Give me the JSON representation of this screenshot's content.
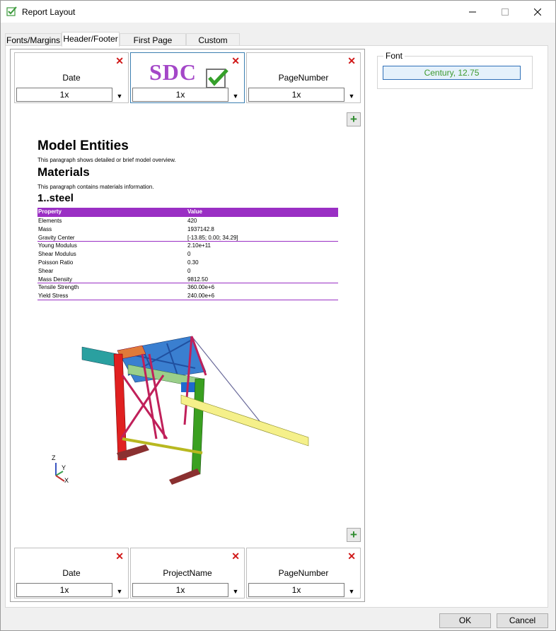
{
  "window": {
    "title": "Report Layout",
    "app_icon": "check-icon"
  },
  "tabs": [
    "Fonts/Margins",
    "Header/Footer",
    "First Page Layout",
    "Custom Fields"
  ],
  "header": {
    "slots": [
      {
        "name": "Date",
        "scale": "1x"
      },
      {
        "name": "SDC",
        "scale": "1x"
      },
      {
        "name": "PageNumber",
        "scale": "1x"
      }
    ]
  },
  "footer": {
    "slots": [
      {
        "name": "Date",
        "scale": "1x"
      },
      {
        "name": "ProjectName",
        "scale": "1x"
      },
      {
        "name": "PageNumber",
        "scale": "1x"
      }
    ]
  },
  "document": {
    "h1": "Model Entities",
    "p1": "This paragraph shows detailed or brief model overview.",
    "h2": "Materials",
    "p2": "This paragraph contains materials information.",
    "h3": "1..steel",
    "table": {
      "headers": [
        "Property",
        "Value"
      ],
      "rows": [
        [
          "Elements",
          "420"
        ],
        [
          "Mass",
          "1937142.8"
        ],
        [
          "Gravity Center",
          "[-13.85; 0.00; 34.29]"
        ],
        [
          "Young Modulus",
          "2.10e+11"
        ],
        [
          "Shear Modulus",
          "0"
        ],
        [
          "Poisson Ratio",
          "0.30"
        ],
        [
          "Shear",
          "0"
        ],
        [
          "Mass Density",
          "9812.50"
        ],
        [
          "Tensile Strength",
          "360.00e+6"
        ],
        [
          "Yield Stress",
          "240.00e+6"
        ]
      ]
    },
    "axes": {
      "z": "Z",
      "y": "Y",
      "x": "X"
    }
  },
  "font_panel": {
    "legend": "Font",
    "value": "Century, 12.75"
  },
  "buttons": {
    "ok": "OK",
    "cancel": "Cancel"
  },
  "colors": {
    "accent_purple": "#9a2fc4",
    "delete_red": "#d01818",
    "add_green": "#2e8b2e"
  }
}
